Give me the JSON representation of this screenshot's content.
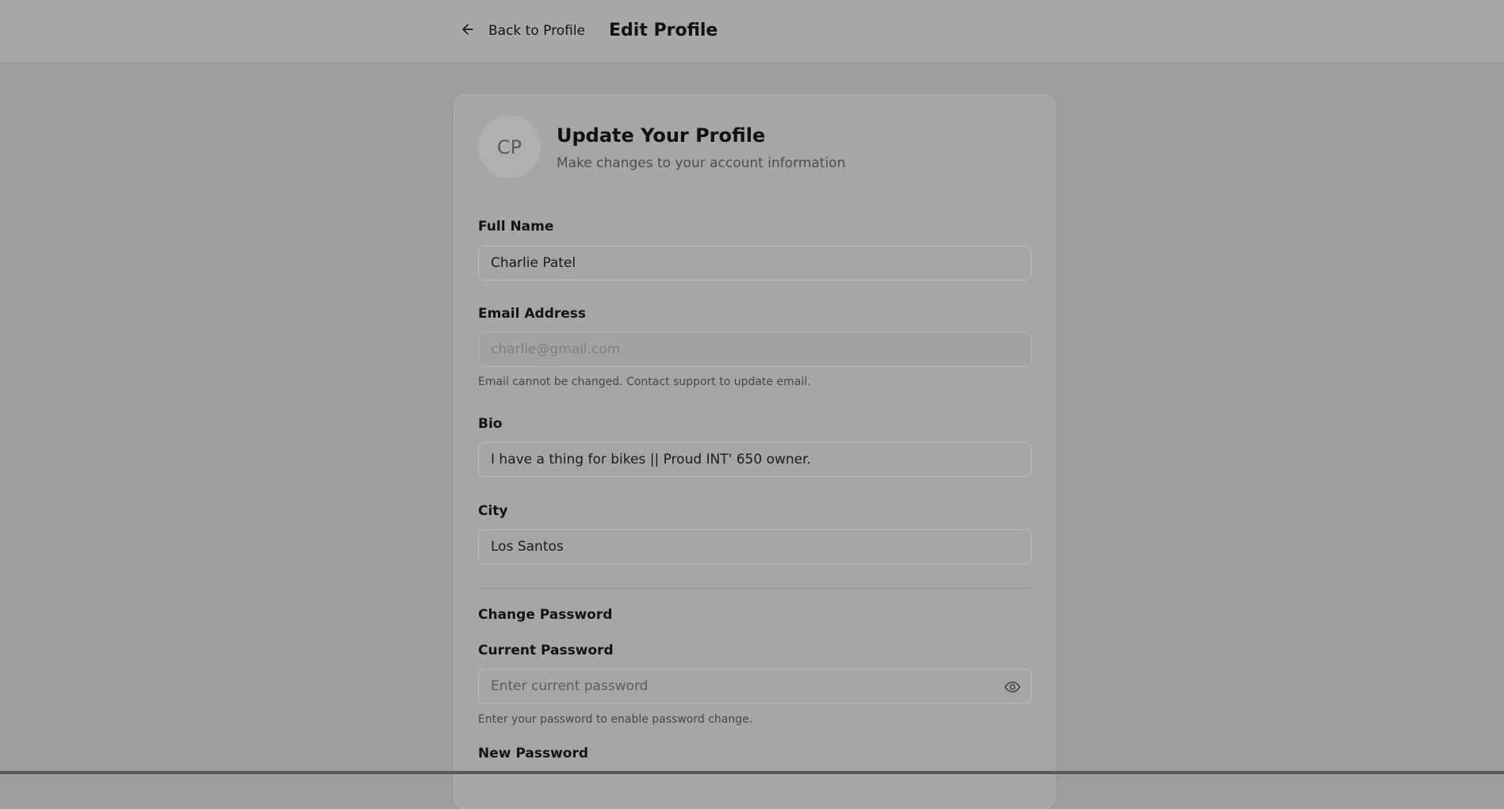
{
  "header": {
    "back_label": "Back to Profile",
    "title": "Edit Profile"
  },
  "profile": {
    "avatar_initials": "CP",
    "title": "Update Your Profile",
    "subtitle": "Make changes to your account information"
  },
  "fields": {
    "full_name": {
      "label": "Full Name",
      "value": "Charlie Patel"
    },
    "email": {
      "label": "Email Address",
      "value": "charlie@gmail.com",
      "hint": "Email cannot be changed. Contact support to update email."
    },
    "bio": {
      "label": "Bio",
      "value": "I have a thing for bikes || Proud INT' 650 owner."
    },
    "city": {
      "label": "City",
      "value": "Los Santos"
    }
  },
  "password": {
    "section_title": "Change Password",
    "current": {
      "label": "Current Password",
      "placeholder": "Enter current password",
      "hint": "Enter your password to enable password change."
    },
    "new": {
      "label": "New Password"
    }
  },
  "icons": {
    "back": "arrow-left-icon",
    "visibility": "eye-icon"
  }
}
